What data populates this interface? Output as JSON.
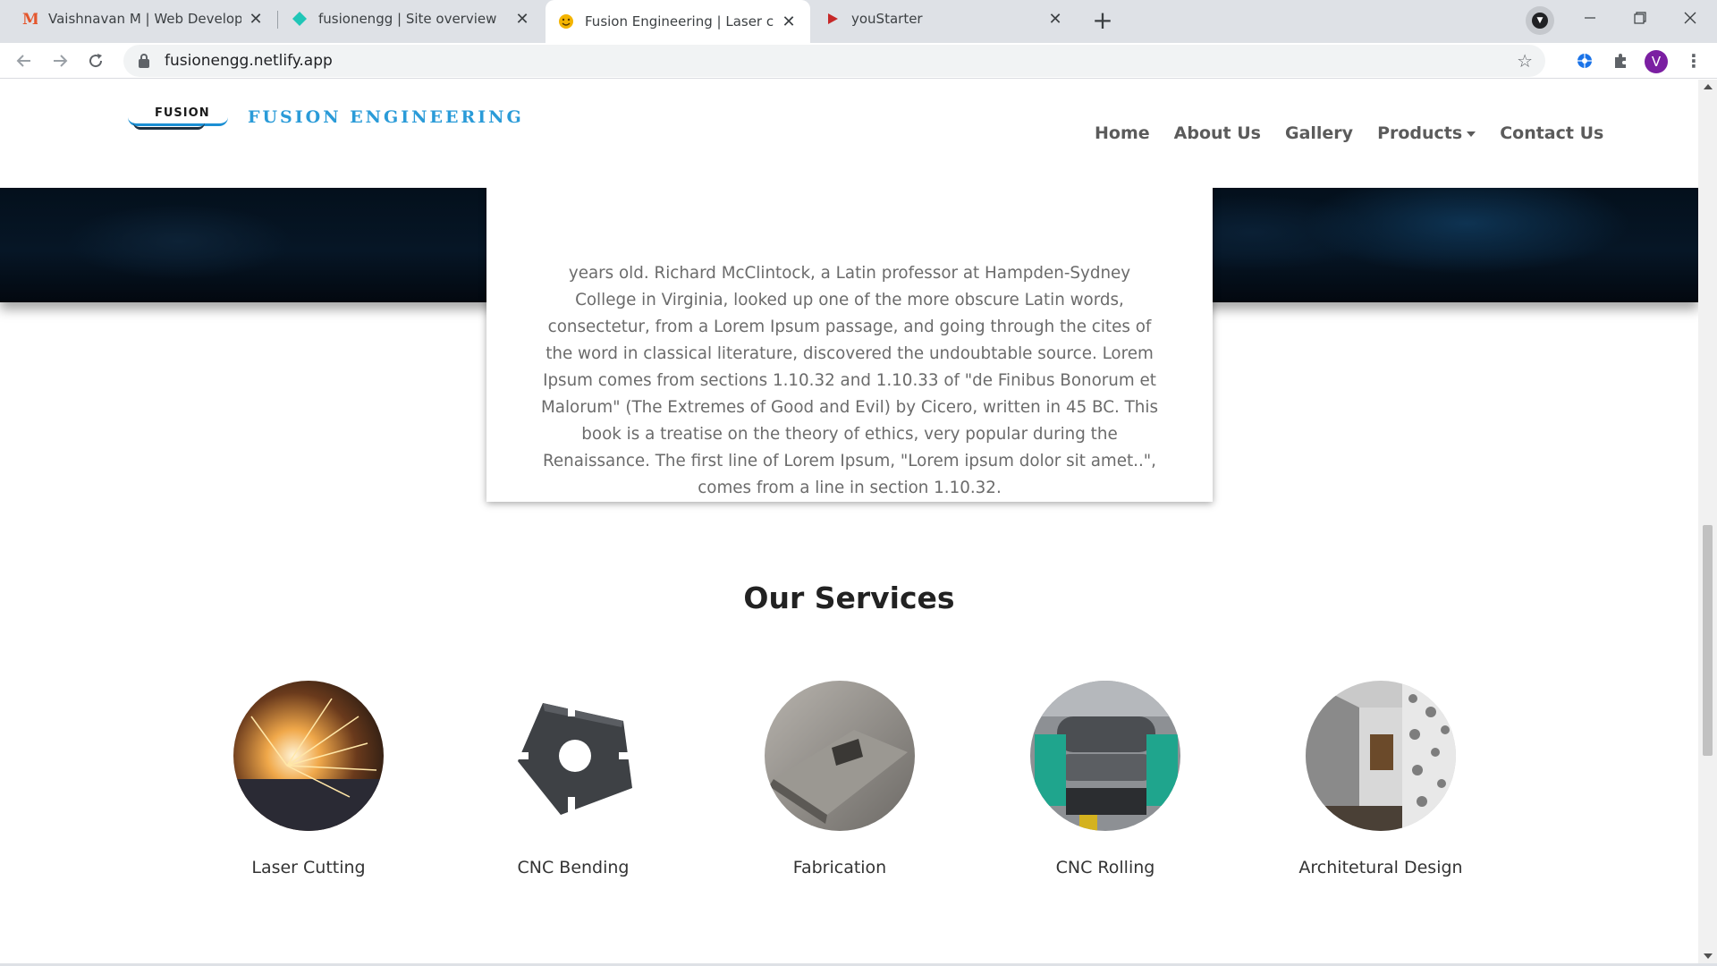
{
  "browser": {
    "tabs": [
      {
        "title": "Vaishnavan M | Web Developer",
        "favicon": "vm-logo-icon",
        "active": false
      },
      {
        "title": "fusionengg | Site overview",
        "favicon": "netlify-diamond-icon",
        "active": false
      },
      {
        "title": "Fusion Engineering | Laser cutting",
        "favicon": "smiley-icon",
        "active": true
      },
      {
        "title": "youStarter",
        "favicon": "play-triangle-icon",
        "active": false
      }
    ],
    "url": "fusionengg.netlify.app",
    "profile_initial": "V",
    "accent": "#7b1fa2"
  },
  "site": {
    "logo_mark_text": "FUSION",
    "logo_text": "FUSION ENGINEERING",
    "nav": [
      "Home",
      "About Us",
      "Gallery",
      "Products",
      "Contact Us"
    ],
    "brand_color": "#2a9bd8"
  },
  "card": {
    "text": "years old. Richard McClintock, a Latin professor at Hampden-Sydney College in Virginia, looked up one of the more obscure Latin words, consectetur, from a Lorem Ipsum passage, and going through the cites of the word in classical literature, discovered the undoubtable source. Lorem Ipsum comes from sections 1.10.32 and 1.10.33 of \"de Finibus Bonorum et Malorum\" (The Extremes of Good and Evil) by Cicero, written in 45 BC. This book is a treatise on the theory of ethics, very popular during the Renaissance. The first line of Lorem Ipsum, \"Lorem ipsum dolor sit amet..\", comes from a line in section 1.10.32."
  },
  "services": {
    "title": "Our Services",
    "items": [
      {
        "label": "Laser Cutting",
        "image": "laser-sparks-image"
      },
      {
        "label": "CNC Bending",
        "image": "metal-part-image"
      },
      {
        "label": "Fabrication",
        "image": "steel-hopper-image"
      },
      {
        "label": "CNC Rolling",
        "image": "rolling-machine-image"
      },
      {
        "label": "Architetural Design",
        "image": "lattice-screen-image"
      }
    ]
  }
}
